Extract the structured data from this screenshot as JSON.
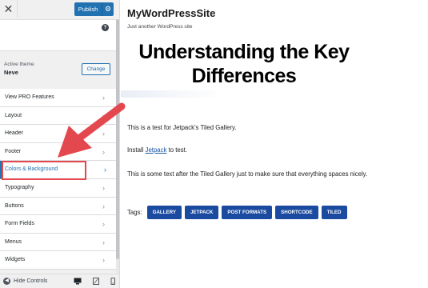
{
  "customizer": {
    "close_icon": "close-icon",
    "publish_label": "Publish",
    "help_icon_glyph": "?",
    "active_theme_label": "Active theme",
    "theme_name": "Neve",
    "change_button_label": "Change",
    "menu_items": [
      {
        "label": "View PRO Features"
      },
      {
        "label": "Layout"
      },
      {
        "label": "Header"
      },
      {
        "label": "Footer"
      },
      {
        "label": "Colors & Background"
      },
      {
        "label": "Typography"
      },
      {
        "label": "Buttons"
      },
      {
        "label": "Form Fields"
      },
      {
        "label": "Menus"
      },
      {
        "label": "Widgets"
      }
    ],
    "active_item": "Colors & Background",
    "hide_controls_label": "Hide Controls",
    "accent_color": "#2271b1",
    "highlight_color": "#e4484f"
  },
  "preview": {
    "site_title": "MyWordPressSite",
    "site_tagline": "Just another WordPress site",
    "post_title_line1": "Understanding the Key",
    "post_title_line2": "Differences",
    "para1": "This is a test for Jetpack's Tiled Gallery.",
    "para2_prefix": "Install ",
    "para2_link": "Jetpack",
    "para2_suffix": " to test.",
    "para3": "This is some text after the Tiled Gallery just to make sure that everything spaces nicely.",
    "tags_label": "Tags:",
    "tags": [
      "GALLERY",
      "JETPACK",
      "POST FORMATS",
      "SHORTCODE",
      "TILED"
    ],
    "tag_color": "#1b4aa1"
  }
}
